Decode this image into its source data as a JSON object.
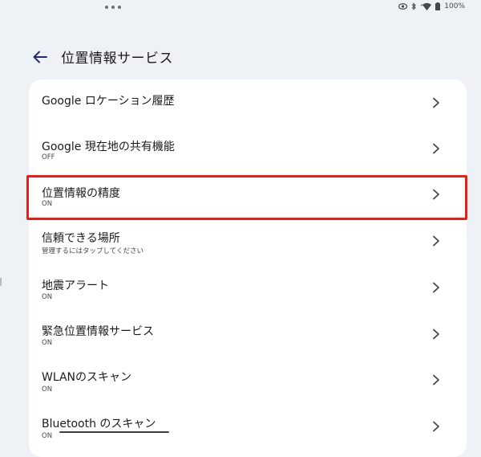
{
  "status_bar": {
    "battery": "100%",
    "icons": [
      "eye-icon",
      "bluetooth-icon",
      "wifi-icon",
      "battery-icon"
    ]
  },
  "header": {
    "title": "位置情報サービス"
  },
  "items": [
    {
      "title": "Google ロケーション履歴",
      "subtitle": ""
    },
    {
      "title": "Google 現在地の共有機能",
      "subtitle": "OFF"
    },
    {
      "title": "位置情報の精度",
      "subtitle": "ON"
    },
    {
      "title": "信頼できる場所",
      "subtitle": "管理するにはタップしてください"
    },
    {
      "title": "地震アラート",
      "subtitle": "ON"
    },
    {
      "title": "緊急位置情報サービス",
      "subtitle": "ON"
    },
    {
      "title": "WLANのスキャン",
      "subtitle": "ON"
    },
    {
      "title": "Bluetooth のスキャン",
      "subtitle": "ON"
    }
  ],
  "colors": {
    "background": "#eef1f6",
    "card": "#ffffff",
    "highlight": "#e32019",
    "back_arrow": "#1f2d6b"
  }
}
